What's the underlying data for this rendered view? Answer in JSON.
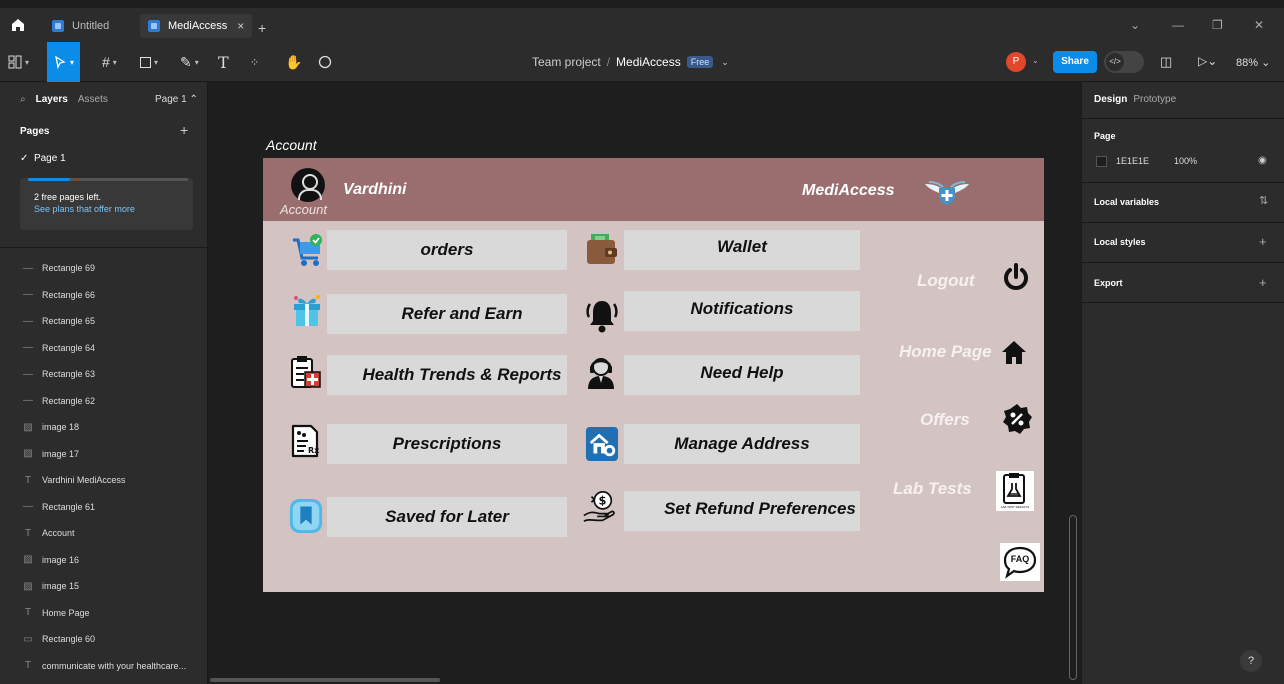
{
  "titlebar": {
    "tabs": [
      {
        "label": "Untitled"
      },
      {
        "label": "MediAccess",
        "close": "×"
      }
    ],
    "new_tab": "+",
    "controls": [
      "⌄",
      "—",
      "❐",
      "✕"
    ]
  },
  "toolbar": {
    "project": "Team project",
    "separator": "/",
    "file": "MediAccess",
    "plan_badge": "Free",
    "avatar_initial": "P",
    "share_label": "Share",
    "zoom": "88%"
  },
  "left_panel": {
    "tab_layers": "Layers",
    "tab_assets": "Assets",
    "page_selector": "Page 1 ⌃",
    "pages_heading": "Pages",
    "add": "+",
    "current_page": "Page 1",
    "promo_title": "2 free pages left.",
    "promo_link": "See plans that offer more",
    "layers": [
      {
        "icon": "—",
        "label": "Rectangle 69"
      },
      {
        "icon": "—",
        "label": "Rectangle 66"
      },
      {
        "icon": "—",
        "label": "Rectangle 65"
      },
      {
        "icon": "—",
        "label": "Rectangle 64"
      },
      {
        "icon": "—",
        "label": "Rectangle 63"
      },
      {
        "icon": "—",
        "label": "Rectangle 62"
      },
      {
        "icon": "▨",
        "label": "image 18"
      },
      {
        "icon": "▨",
        "label": "image 17"
      },
      {
        "icon": "T",
        "label": "Vardhini MediAccess"
      },
      {
        "icon": "—",
        "label": "Rectangle 61"
      },
      {
        "icon": "T",
        "label": "Account"
      },
      {
        "icon": "▨",
        "label": "image 16"
      },
      {
        "icon": "▨",
        "label": "image 15"
      },
      {
        "icon": "T",
        "label": "Home Page"
      },
      {
        "icon": "▭",
        "label": "Rectangle 60"
      },
      {
        "icon": "T",
        "label": "communicate with your healthcare..."
      }
    ]
  },
  "right_panel": {
    "tab_design": "Design",
    "tab_prototype": "Prototype",
    "page_heading": "Page",
    "page_color": "1E1E1E",
    "page_opacity": "100%",
    "local_variables": "Local variables",
    "local_styles": "Local styles",
    "export": "Export",
    "add": "+",
    "help": "?"
  },
  "canvas": {
    "frame_label": "Account",
    "header": {
      "account_sub": "Account",
      "user_name": "Vardhini",
      "brand": "MediAccess"
    },
    "menu_left": [
      {
        "label": "orders",
        "icon": "cart-icon"
      },
      {
        "label": "Refer and Earn",
        "icon": "gift-icon"
      },
      {
        "label": "Health Trends & Reports",
        "icon": "clipboard-report-icon"
      },
      {
        "label": "Prescriptions",
        "icon": "prescription-icon"
      },
      {
        "label": "Saved for Later",
        "icon": "bookmark-icon"
      }
    ],
    "menu_right": [
      {
        "label": "Wallet",
        "icon": "wallet-icon"
      },
      {
        "label": "Notifications",
        "icon": "bell-icon"
      },
      {
        "label": "Need Help",
        "icon": "support-agent-icon"
      },
      {
        "label": "Manage Address",
        "icon": "home-address-icon"
      },
      {
        "label": "Set Refund Preferences",
        "icon": "refund-hand-icon"
      }
    ],
    "side_links": [
      {
        "label": "Logout",
        "icon": "power-icon"
      },
      {
        "label": "Home Page",
        "icon": "house-icon"
      },
      {
        "label": "Offers",
        "icon": "discount-badge-icon"
      },
      {
        "label": "Lab Tests",
        "icon": "lab-clipboard-icon"
      }
    ],
    "lab_icon_caption": "LAB TEST RESULTS",
    "faq_label": "FAQ",
    "colors": {
      "header": "#9a6e6e",
      "body": "#d4c3c3",
      "tile": "#d9d9d9"
    }
  }
}
